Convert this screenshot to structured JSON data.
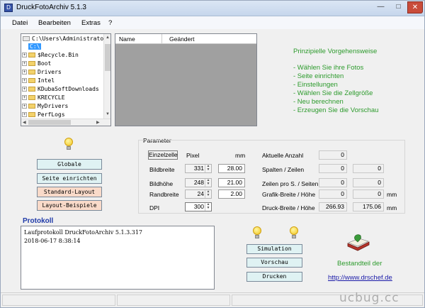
{
  "window": {
    "title": "DruckFotoArchiv  5.1.3",
    "app_icon": "D"
  },
  "menu": [
    "Datei",
    "Bearbeiten",
    "Extras",
    "?"
  ],
  "tree": {
    "items": [
      "C:\\Users\\Administrator\\",
      "C:\\",
      "$Recycle.Bin",
      "Boot",
      "Drivers",
      "Intel",
      "KDubaSoftDownloads",
      "KRECYCLE",
      "MyDrivers",
      "PerfLogs"
    ]
  },
  "filelist": {
    "columns": [
      "Name",
      "Geändert"
    ]
  },
  "prinzip": {
    "title": "Prinzipielle Vorgehensweise",
    "steps": [
      "- Wählen Sie ihre Fotos",
      "- Seite einrichten",
      "- Einstellungen",
      "- Wählen Sie die Zellgröße",
      "- Neu berechnen",
      "- Erzeugen Sie die Vorschau"
    ]
  },
  "left_buttons": {
    "globale": "Globale",
    "seite": "Seite einrichten",
    "standard": "Standard-Layout",
    "layout": "Layout-Beispiele"
  },
  "param": {
    "title": "Parameter",
    "einzelzelle": "Einzelzelle",
    "pixel": "Pixel",
    "mm": "mm",
    "rows": [
      {
        "label": "Bildbreite",
        "pixel": "331",
        "mm": "28.00"
      },
      {
        "label": "Bildhöhe",
        "pixel": "248",
        "mm": "21.00"
      },
      {
        "label": "Randbreite",
        "pixel": "24",
        "mm": "2.00"
      },
      {
        "label": "DPI",
        "pixel": "300",
        "mm": ""
      }
    ],
    "right": [
      {
        "label": "Aktuelle Anzahl",
        "v1": "0",
        "v2": "",
        "unit": ""
      },
      {
        "label": "Spalten / Zeilen",
        "v1": "0",
        "v2": "0",
        "unit": ""
      },
      {
        "label": "Zeilen pro S. / Seiten",
        "v1": "0",
        "v2": "0",
        "unit": ""
      },
      {
        "label": "Grafik-Breite / Höhe",
        "v1": "0",
        "v2": "0",
        "unit": "mm"
      },
      {
        "label": "Druck-Breite / Höhe",
        "v1": "266.93",
        "v2": "175.06",
        "unit": "mm"
      }
    ]
  },
  "protokoll": {
    "title": "Protokoll",
    "lines": [
      "Laufprotokoll DruckFotoArchiv 5.1.3.317",
      "2018-06-17 8:38:14"
    ]
  },
  "actions": {
    "simulation": "Simulation",
    "vorschau": "Vorschau",
    "drucken": "Drucken"
  },
  "bestandteil": "Bestandteil der",
  "link": "http://www.drschef.de",
  "watermark": "ucbug.cc",
  "colors": {
    "accent_green": "#2c9a2c",
    "link_blue": "#1a1aa8",
    "title_blue": "#1f3aa8"
  }
}
